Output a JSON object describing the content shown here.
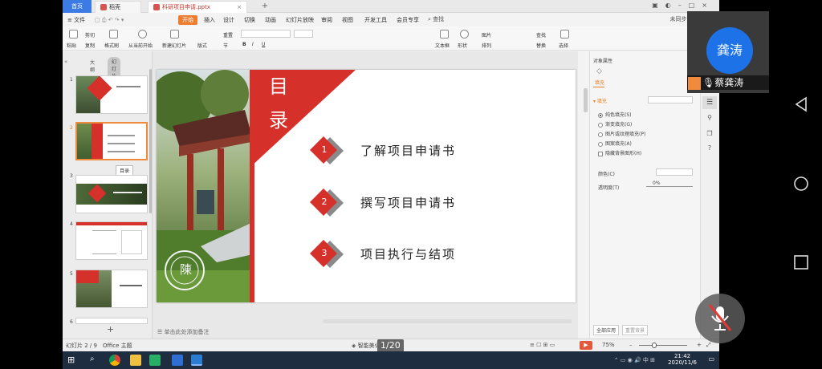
{
  "titlebar": {
    "home_tab": "首页",
    "draft_tab": "稻壳",
    "doc_tab": "科研项目申请.pptx",
    "new_tab": "+"
  },
  "menu": {
    "file": "≡ 文件",
    "items": [
      "开始",
      "插入",
      "设计",
      "切换",
      "动画",
      "幻灯片放映",
      "审阅",
      "视图",
      "开发工具",
      "会员专享"
    ],
    "search": "查找",
    "right": "未同步   协作   分享"
  },
  "ribbon": {
    "paste": "粘贴",
    "cut": "剪切",
    "copy": "复制",
    "format_painter": "格式刷",
    "from_current": "从当前开始",
    "new_slide": "新建幻灯片",
    "layout": "版式",
    "section": "节",
    "reset": "重置",
    "bold": "B",
    "italic": "I",
    "underline": "U",
    "textbox": "文本框",
    "shape": "形状",
    "arrange": "排列",
    "picture": "图片",
    "find": "查找",
    "replace": "替换",
    "select": "选择"
  },
  "leftpane": {
    "outline_tab": "大纲",
    "slides_tab": "幻灯片",
    "thumb_numbers": [
      "1",
      "2",
      "3",
      "4",
      "5",
      "6"
    ],
    "tooltip": "目录",
    "add": "+"
  },
  "slide": {
    "title_chars": [
      "目",
      "录"
    ],
    "items": [
      {
        "num": "1",
        "text": "了解项目申请书"
      },
      {
        "num": "2",
        "text": "撰写项目申请书"
      },
      {
        "num": "3",
        "text": "项目执行与结项"
      }
    ],
    "seal_char": "陳"
  },
  "notes": "单击此处添加备注",
  "rightpanel": {
    "header": "对象属性",
    "tab_fill": "填充",
    "fill_section": "填充",
    "options": [
      "纯色填充(S)",
      "渐变填充(G)",
      "图片或纹理填充(P)",
      "图案填充(A)",
      "隐藏背景图形(H)"
    ],
    "selected_option": "纯色填充(S)",
    "color_label": "颜色(C)",
    "transparency_label": "透明度(T)",
    "transparency_value": "0%",
    "apply_all": "全部应用",
    "reset_bg": "重置背景"
  },
  "statusbar": {
    "slide_info": "幻灯片 2 / 9",
    "theme": "Office 主题",
    "smart": "智能美化",
    "page_counter": "1/20",
    "zoom": "75%"
  },
  "taskbar": {
    "time": "21:42",
    "date": "2020/11/6",
    "ime": "中"
  },
  "video": {
    "avatar_text": "龚涛",
    "participant_name": "蔡龚涛"
  },
  "colors": {
    "accent": "#d6302b",
    "wps_orange": "#ee7d2f",
    "avatar_blue": "#1d72e8"
  }
}
